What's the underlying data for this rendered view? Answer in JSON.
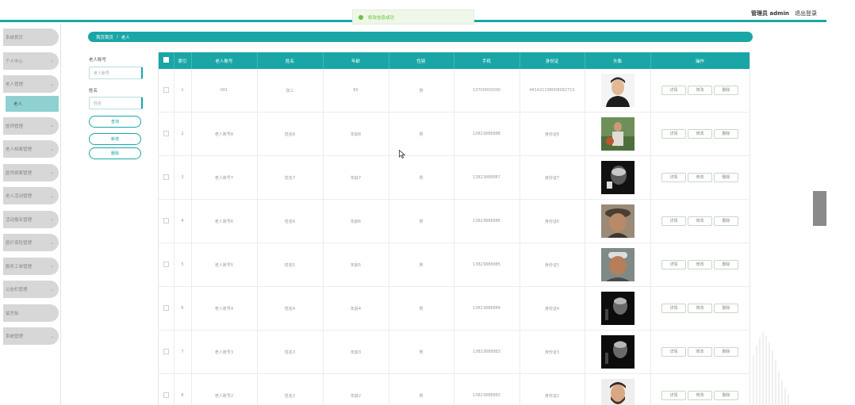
{
  "header": {
    "user_label": "管理员 admin",
    "logout": "退出登录",
    "toast": "修改信息成功"
  },
  "sidebar": {
    "items": [
      {
        "label": "系统首页",
        "chevron": false
      },
      {
        "label": "个人中心",
        "chevron": true
      },
      {
        "label": "老人管理",
        "chevron": true
      },
      {
        "label": "医师管理",
        "chevron": true
      },
      {
        "label": "老人档案管理",
        "chevron": true
      },
      {
        "label": "医师病案管理",
        "chevron": true
      },
      {
        "label": "老人活动管理",
        "chevron": true
      },
      {
        "label": "活动报名管理",
        "chevron": true
      },
      {
        "label": "医疗保险管理",
        "chevron": true
      },
      {
        "label": "服务工单管理",
        "chevron": true
      },
      {
        "label": "公告栏管理",
        "chevron": true
      },
      {
        "label": "留言板",
        "chevron": false
      },
      {
        "label": "系统管理",
        "chevron": true
      }
    ],
    "active_sub": "老人"
  },
  "breadcrumb": {
    "home": "首页首页",
    "sep": "/",
    "current": "老人"
  },
  "filters": {
    "account_label": "老人账号",
    "account_placeholder": "老人账号",
    "name_label": "姓名",
    "name_placeholder": "姓名",
    "query": "查询",
    "add": "新增",
    "delete": "删除"
  },
  "table": {
    "columns": [
      "索引",
      "老人账号",
      "姓名",
      "年龄",
      "性别",
      "手机",
      "身份证",
      "头像",
      "操作"
    ],
    "actions": [
      "详情",
      "修改",
      "删除"
    ],
    "rows": [
      {
        "index": "1",
        "account": "001",
        "name": "张三",
        "age": "60",
        "gender": "男",
        "phone": "13700000000",
        "idcard": "44142119800808271S",
        "avatar": "young-man"
      },
      {
        "index": "2",
        "account": "老人账号8",
        "name": "姓名8",
        "age": "年龄8",
        "gender": "男",
        "phone": "13823888888",
        "idcard": "身份证8",
        "avatar": "elder-garden"
      },
      {
        "index": "3",
        "account": "老人账号7",
        "name": "姓名7",
        "age": "年龄7",
        "gender": "男",
        "phone": "13823888887",
        "idcard": "身份证7",
        "avatar": "elder-bw"
      },
      {
        "index": "4",
        "account": "老人账号6",
        "name": "姓名6",
        "age": "年龄6",
        "gender": "男",
        "phone": "13823888886",
        "idcard": "身份证6",
        "avatar": "elder-hat"
      },
      {
        "index": "5",
        "account": "老人账号5",
        "name": "姓名5",
        "age": "年龄5",
        "gender": "男",
        "phone": "13823888885",
        "idcard": "身份证5",
        "avatar": "elder-cap"
      },
      {
        "index": "6",
        "account": "老人账号4",
        "name": "姓名4",
        "age": "年龄4",
        "gender": "男",
        "phone": "13823888884",
        "idcard": "身份证4",
        "avatar": "elder-dark"
      },
      {
        "index": "7",
        "account": "老人账号3",
        "name": "姓名3",
        "age": "年龄3",
        "gender": "男",
        "phone": "13823888883",
        "idcard": "身份证3",
        "avatar": "elder-dark"
      },
      {
        "index": "8",
        "account": "老人账号2",
        "name": "姓名2",
        "age": "年龄2",
        "gender": "男",
        "phone": "13823888882",
        "idcard": "身份证2",
        "avatar": "man-beard"
      }
    ]
  },
  "colors": {
    "accent": "#1aa6a6",
    "sidebar_active": "#8fd0d2",
    "toast_green": "#67c23a"
  }
}
